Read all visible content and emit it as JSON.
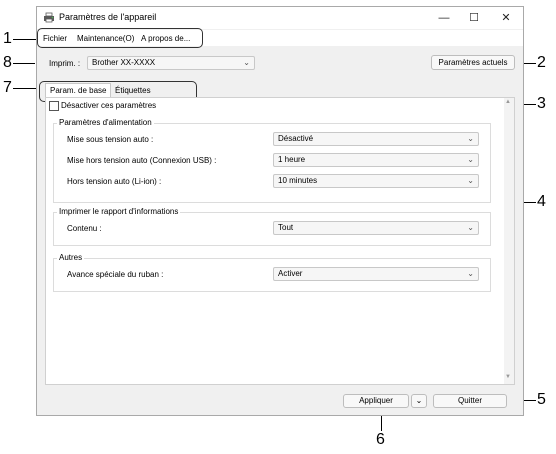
{
  "window": {
    "title": "Paramètres de l'appareil",
    "controls": {
      "minimize": "—",
      "maximize": "☐",
      "close": "✕"
    }
  },
  "menu": {
    "items": [
      {
        "label": "Fichier"
      },
      {
        "label": "Maintenance(O)"
      },
      {
        "label": "A propos de..."
      }
    ]
  },
  "printer": {
    "label": "Imprim. :",
    "selected": "Brother  XX-XXXX"
  },
  "current_settings_button": "Paramètres actuels",
  "tabs": [
    {
      "label": "Param. de base"
    },
    {
      "label": "Étiquettes"
    }
  ],
  "disable_checkbox_label": "Désactiver ces paramètres",
  "groups": {
    "power": {
      "title": "Paramètres d'alimentation",
      "rows": [
        {
          "label": "Mise sous tension auto :",
          "value": "Désactivé"
        },
        {
          "label": "Mise hors tension auto (Connexion USB) :",
          "value": "1 heure"
        },
        {
          "label": "Hors tension auto (Li-ion) :",
          "value": "10 minutes"
        }
      ]
    },
    "report": {
      "title": "Imprimer le rapport d'informations",
      "rows": [
        {
          "label": "Contenu :",
          "value": "Tout"
        }
      ]
    },
    "other": {
      "title": "Autres",
      "rows": [
        {
          "label": "Avance spéciale du ruban :",
          "value": "Activer"
        }
      ]
    }
  },
  "footer": {
    "apply_button": "Appliquer",
    "quit_button": "Quitter"
  },
  "callouts": [
    "1",
    "2",
    "3",
    "4",
    "5",
    "6",
    "7",
    "8"
  ],
  "icons": {
    "app": "printer-settings-icon",
    "dropdown": "chevron-down-icon"
  }
}
